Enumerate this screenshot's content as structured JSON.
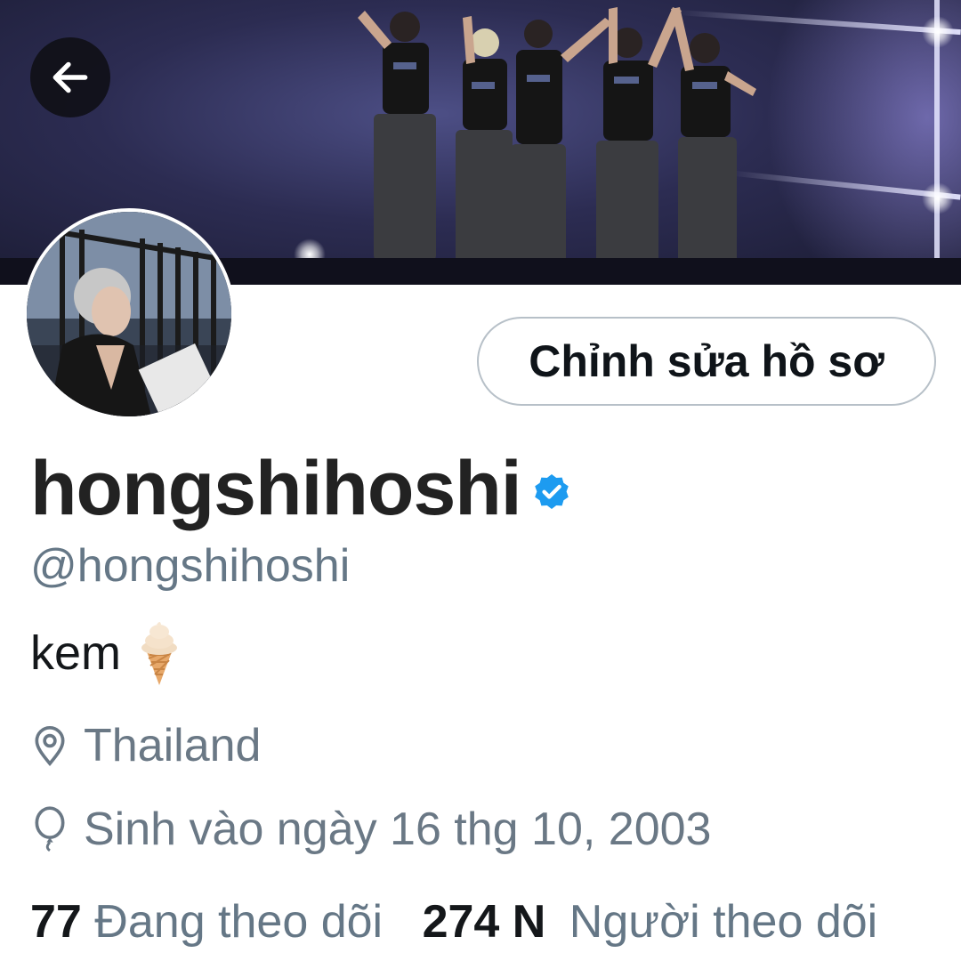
{
  "header": {
    "back_icon": "arrow-left-icon",
    "edit_profile_label": "Chỉnh sửa hồ sơ"
  },
  "profile": {
    "display_name": "hongshihoshi",
    "verified_icon": "verified-badge-icon",
    "handle": "@hongshihoshi",
    "bio_text": "kem",
    "bio_emoji": "ice-cream-icon",
    "location_icon": "location-pin-icon",
    "location": "Thailand",
    "birthday_icon": "balloon-icon",
    "birthday": "Sinh vào ngày 16 thg 10, 2003"
  },
  "stats": {
    "following_count": "77",
    "following_label": "Đang theo dõi",
    "followers_count": "274 N",
    "followers_label": "Người theo dõi"
  },
  "colors": {
    "verified": "#1d9bf0",
    "secondary_text": "#657786",
    "primary_text": "#14171a"
  }
}
